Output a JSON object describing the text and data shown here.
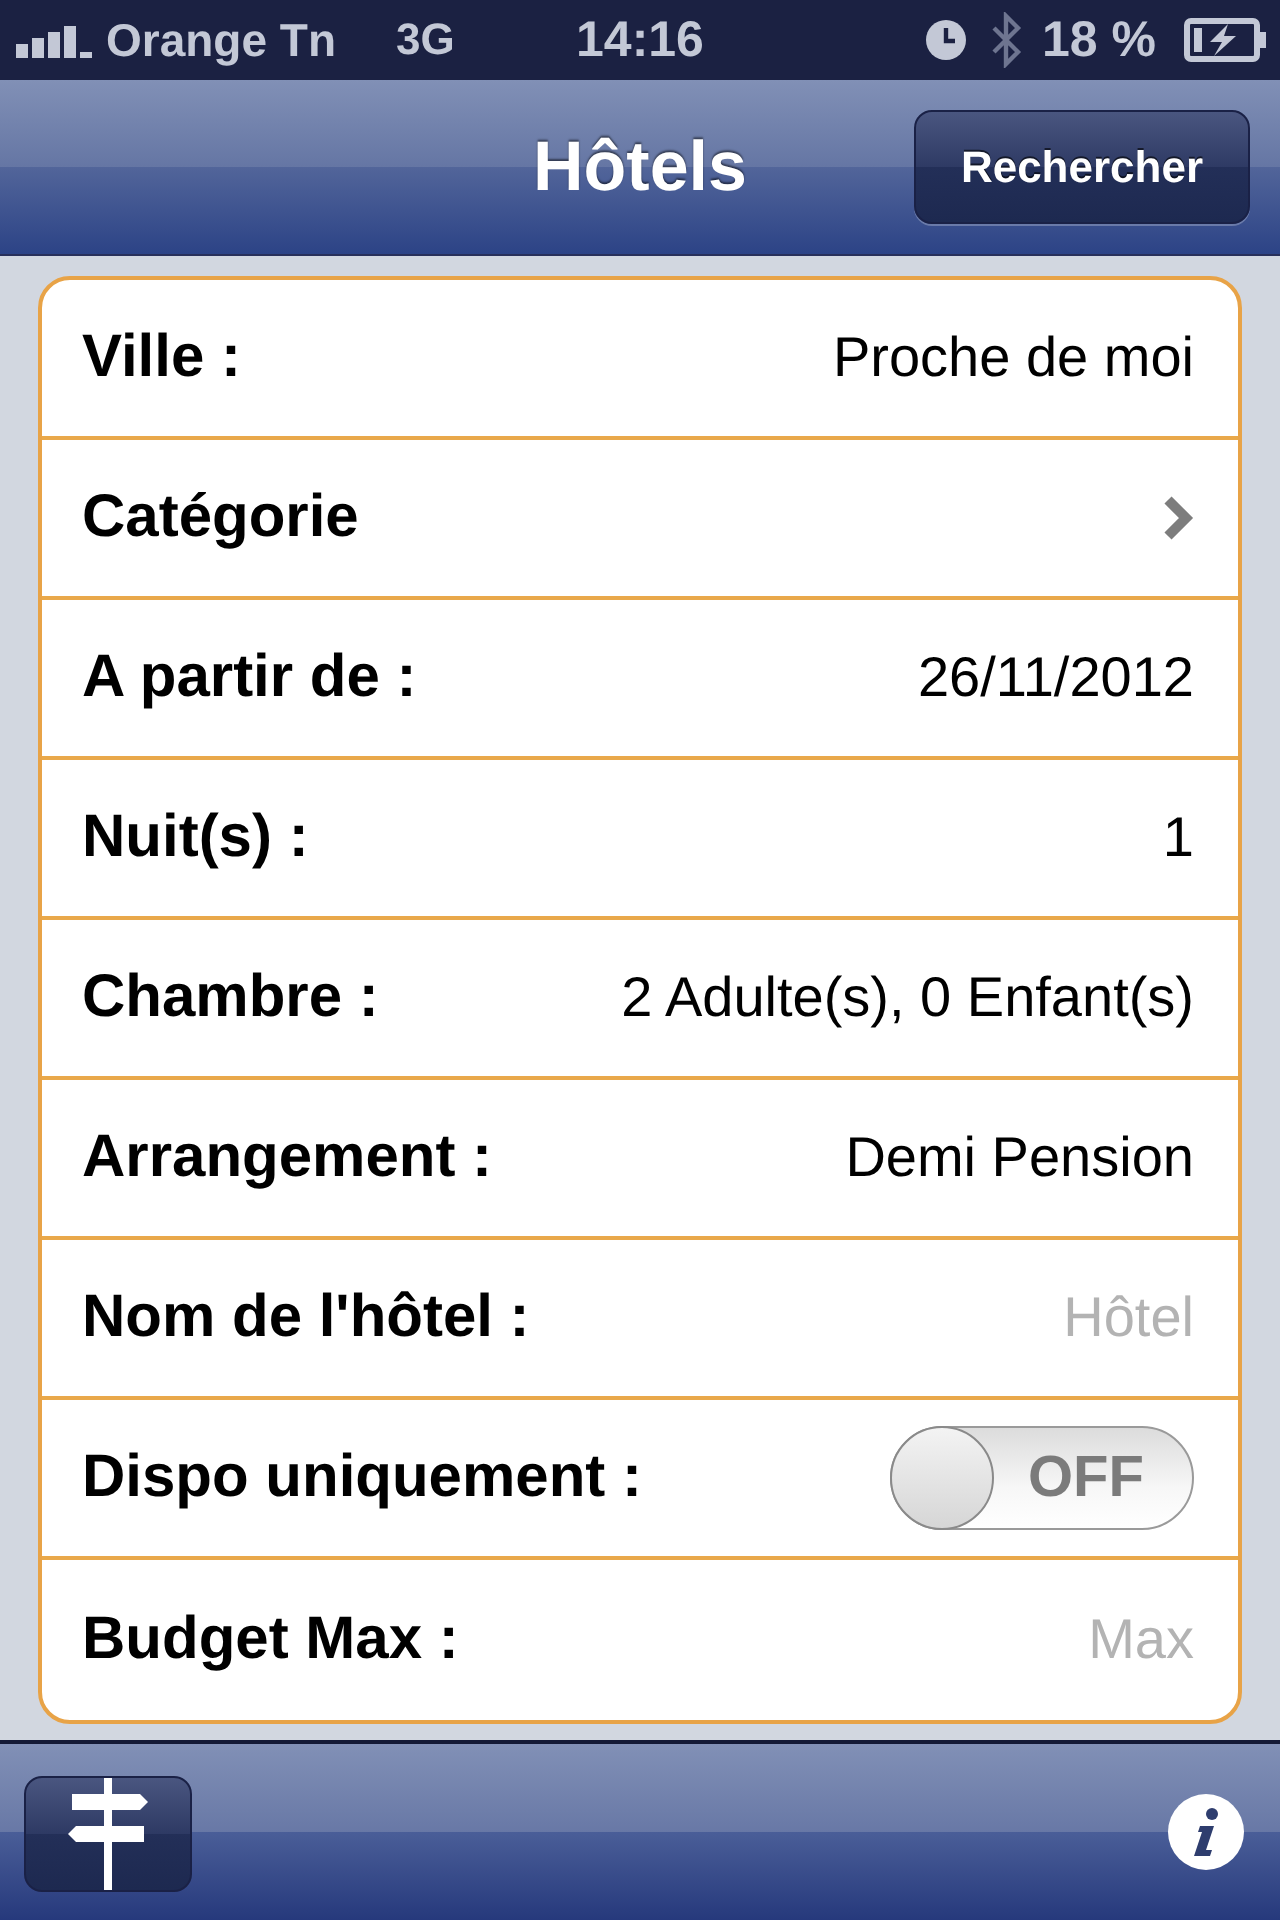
{
  "status_bar": {
    "carrier": "Orange Tn",
    "network": "3G",
    "time": "14:16",
    "battery": "18 %"
  },
  "nav_bar": {
    "title": "Hôtels",
    "search_button": "Rechercher"
  },
  "form": {
    "rows": [
      {
        "kind": "value",
        "label": "Ville :",
        "value": "Proche de moi"
      },
      {
        "kind": "disclosure",
        "label": "Catégorie"
      },
      {
        "kind": "value",
        "label": "A partir de :",
        "value": "26/11/2012"
      },
      {
        "kind": "value",
        "label": "Nuit(s) :",
        "value": "1"
      },
      {
        "kind": "value",
        "label": "Chambre :",
        "value": "2 Adulte(s), 0 Enfant(s)"
      },
      {
        "kind": "value",
        "label": "Arrangement :",
        "value": "Demi Pension"
      },
      {
        "kind": "field",
        "label": "Nom de l'hôtel :",
        "placeholder": "Hôtel"
      },
      {
        "kind": "toggle",
        "label": "Dispo uniquement :",
        "on": false,
        "toggle_text": "OFF"
      },
      {
        "kind": "field",
        "label": "Budget Max :",
        "placeholder": "Max"
      }
    ]
  }
}
